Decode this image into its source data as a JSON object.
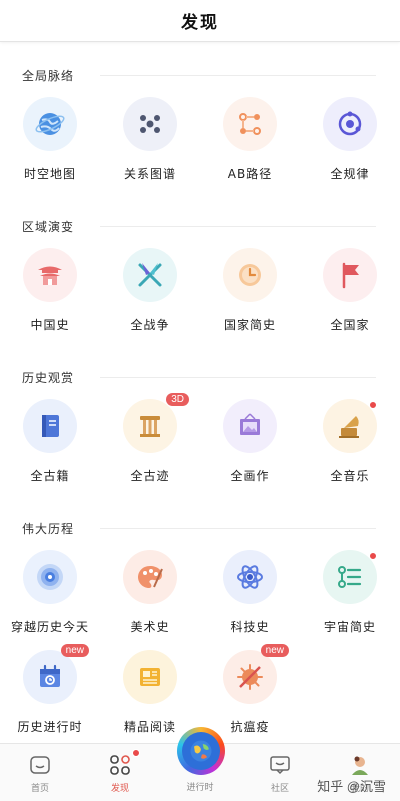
{
  "header": {
    "title": "发现"
  },
  "sections": [
    {
      "title": "全局脉络",
      "items": [
        {
          "label": "时空地图",
          "icon": "globe-icon"
        },
        {
          "label": "关系图谱",
          "icon": "graph-icon"
        },
        {
          "label": "AB路径",
          "icon": "path-icon"
        },
        {
          "label": "全规律",
          "icon": "orbit-icon"
        }
      ]
    },
    {
      "title": "区域演变",
      "items": [
        {
          "label": "中国史",
          "icon": "pavilion-icon"
        },
        {
          "label": "全战争",
          "icon": "crossed-swords-icon"
        },
        {
          "label": "国家简史",
          "icon": "clock-icon"
        },
        {
          "label": "全国家",
          "icon": "flag-icon"
        }
      ]
    },
    {
      "title": "历史观赏",
      "items": [
        {
          "label": "全古籍",
          "icon": "book-icon"
        },
        {
          "label": "全古迹",
          "icon": "column-icon",
          "badge": "3D"
        },
        {
          "label": "全画作",
          "icon": "painting-icon"
        },
        {
          "label": "全音乐",
          "icon": "gramophone-icon",
          "dot": true
        }
      ]
    },
    {
      "title": "伟大历程",
      "items": [
        {
          "label": "穿越历史今天",
          "icon": "tunnel-icon"
        },
        {
          "label": "美术史",
          "icon": "palette-icon"
        },
        {
          "label": "科技史",
          "icon": "atom-icon"
        },
        {
          "label": "宇宙简史",
          "icon": "timeline-icon",
          "dot": true
        },
        {
          "label": "历史进行时",
          "icon": "calendar-icon",
          "badge": "new"
        },
        {
          "label": "精品阅读",
          "icon": "newspaper-icon"
        },
        {
          "label": "抗瘟疫",
          "icon": "virus-icon",
          "badge": "new"
        }
      ]
    }
  ],
  "tabbar": {
    "items": [
      {
        "label": "首页",
        "icon": "home-icon"
      },
      {
        "label": "发现",
        "icon": "discover-icon",
        "active": true,
        "dot": true
      },
      {
        "label": "进行时",
        "icon": "globe-center-icon"
      },
      {
        "label": "社区",
        "icon": "chat-icon"
      },
      {
        "label": "我的",
        "icon": "avatar-icon"
      }
    ]
  },
  "watermark": "知乎 @沉雪"
}
